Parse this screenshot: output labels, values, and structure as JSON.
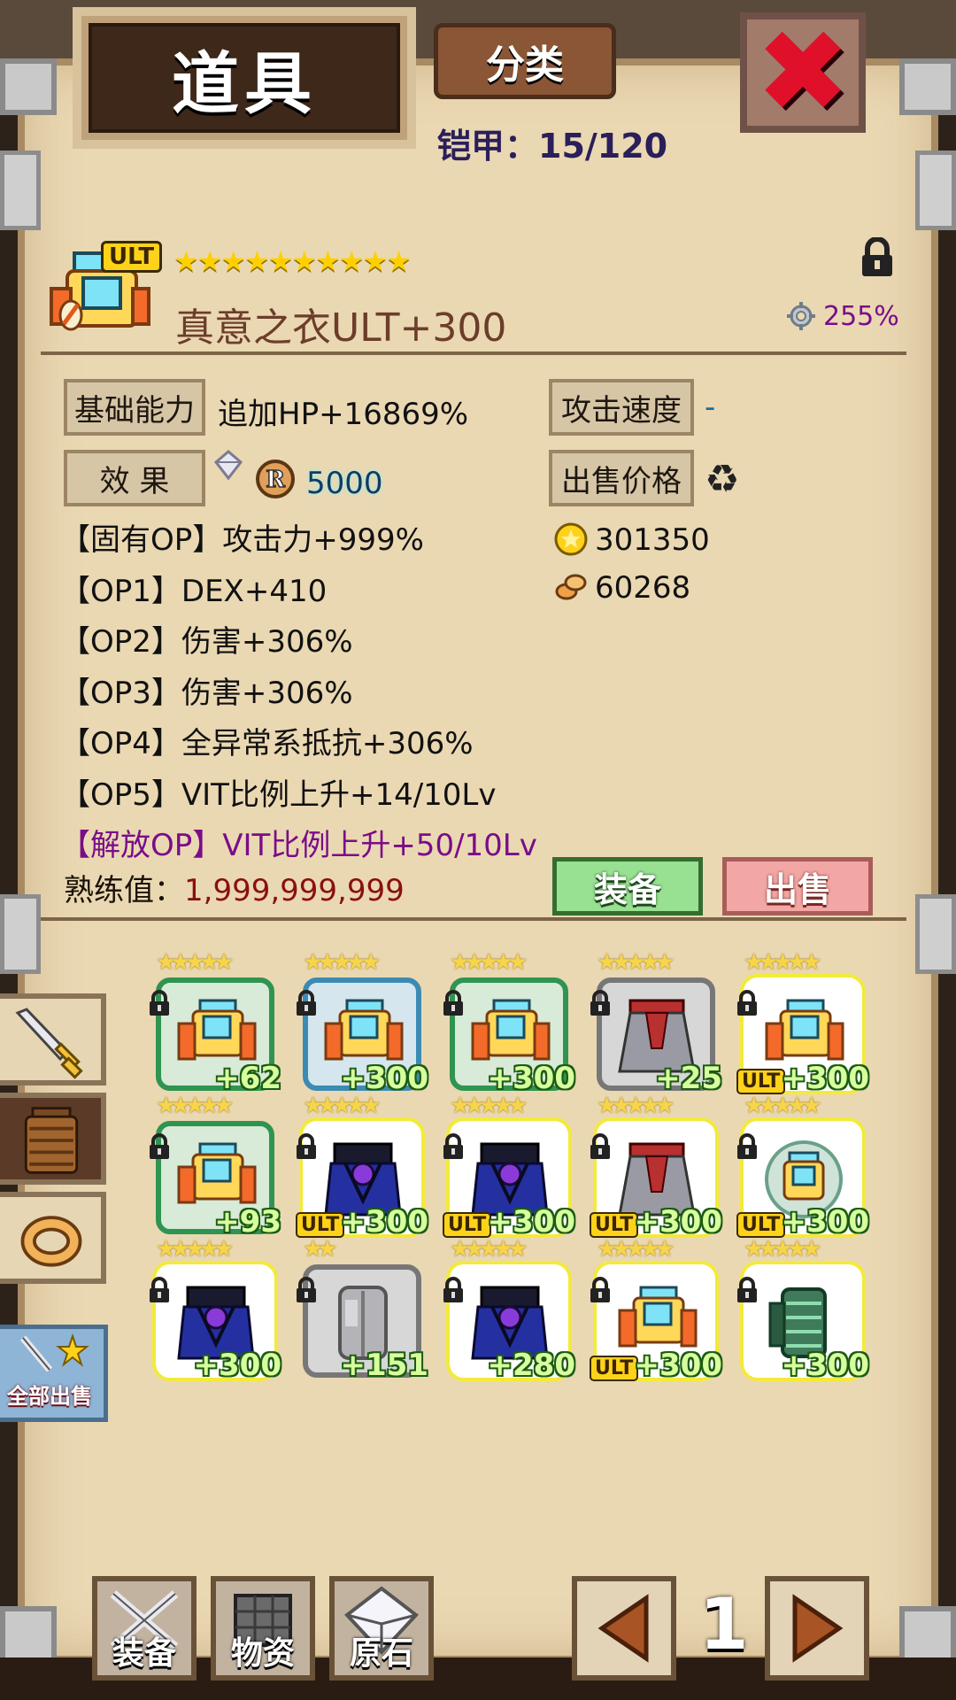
{
  "header": {
    "title": "道具",
    "classify_label": "分类",
    "armor_count": "铠甲：15/120"
  },
  "item": {
    "tag": "ULT",
    "stars": "★★★★★★★★★★",
    "name": "真意之衣ULT+300",
    "percent": "255%"
  },
  "stats": {
    "base_label": "基础能力",
    "base_value": "追加HP+16869%",
    "attack_speed_label": "攻击速度",
    "attack_speed_value": "-",
    "effect_label": "效 果",
    "effect_value": "5000",
    "sell_price_label": "出售价格",
    "gold_price": "301350",
    "material_price": "60268"
  },
  "options": [
    "【固有OP】攻击力+999%",
    "【OP1】DEX+410",
    "【OP2】伤害+306%",
    "【OP3】伤害+306%",
    "【OP4】全异常系抵抗+306%",
    "【OP5】VIT比例上升+14/10Lv",
    "【解放OP】VIT比例上升+50/10Lv"
  ],
  "mastery": {
    "label": "熟练值：",
    "value": "1,999,999,999"
  },
  "actions": {
    "equip": "装备",
    "sell": "出售"
  },
  "sell_all": "全部出售",
  "grid": [
    {
      "plus": "+62",
      "ult": "",
      "frame": "green",
      "art": "shirt",
      "stars": "★★★★★"
    },
    {
      "plus": "+300",
      "ult": "",
      "frame": "blue",
      "art": "shirt",
      "stars": "★★★★★"
    },
    {
      "plus": "+300",
      "ult": "",
      "frame": "green",
      "art": "shirt",
      "stars": "★★★★★"
    },
    {
      "plus": "+25",
      "ult": "",
      "frame": "gray",
      "art": "cape",
      "stars": "★★★★★"
    },
    {
      "plus": "+300",
      "ult": "ULT",
      "frame": "white",
      "art": "shirt",
      "stars": "★★★★★"
    },
    {
      "plus": "+93",
      "ult": "",
      "frame": "green",
      "art": "shirt",
      "stars": "★★★★★"
    },
    {
      "plus": "+300",
      "ult": "ULT",
      "frame": "white",
      "art": "robe",
      "stars": "★★★★★"
    },
    {
      "plus": "+300",
      "ult": "ULT",
      "frame": "white",
      "art": "robe",
      "stars": "★★★★★"
    },
    {
      "plus": "+300",
      "ult": "ULT",
      "frame": "white",
      "art": "cape",
      "stars": "★★★★★"
    },
    {
      "plus": "+300",
      "ult": "ULT",
      "frame": "white",
      "art": "shield",
      "stars": "★★★★★"
    },
    {
      "plus": "+300",
      "ult": "",
      "frame": "white",
      "art": "robe",
      "stars": "★★★★★"
    },
    {
      "plus": "+151",
      "ult": "",
      "frame": "gray",
      "art": "plate",
      "stars": "★★"
    },
    {
      "plus": "+280",
      "ult": "",
      "frame": "white",
      "art": "robe",
      "stars": "★★★★★"
    },
    {
      "plus": "+300",
      "ult": "ULT",
      "frame": "white",
      "art": "shirt",
      "stars": "★★★★★"
    },
    {
      "plus": "+300",
      "ult": "",
      "frame": "white",
      "art": "jade",
      "stars": "★★★★★"
    }
  ],
  "bottom_nav": [
    {
      "label": "装备"
    },
    {
      "label": "物资"
    },
    {
      "label": "原石"
    }
  ],
  "page": "1"
}
